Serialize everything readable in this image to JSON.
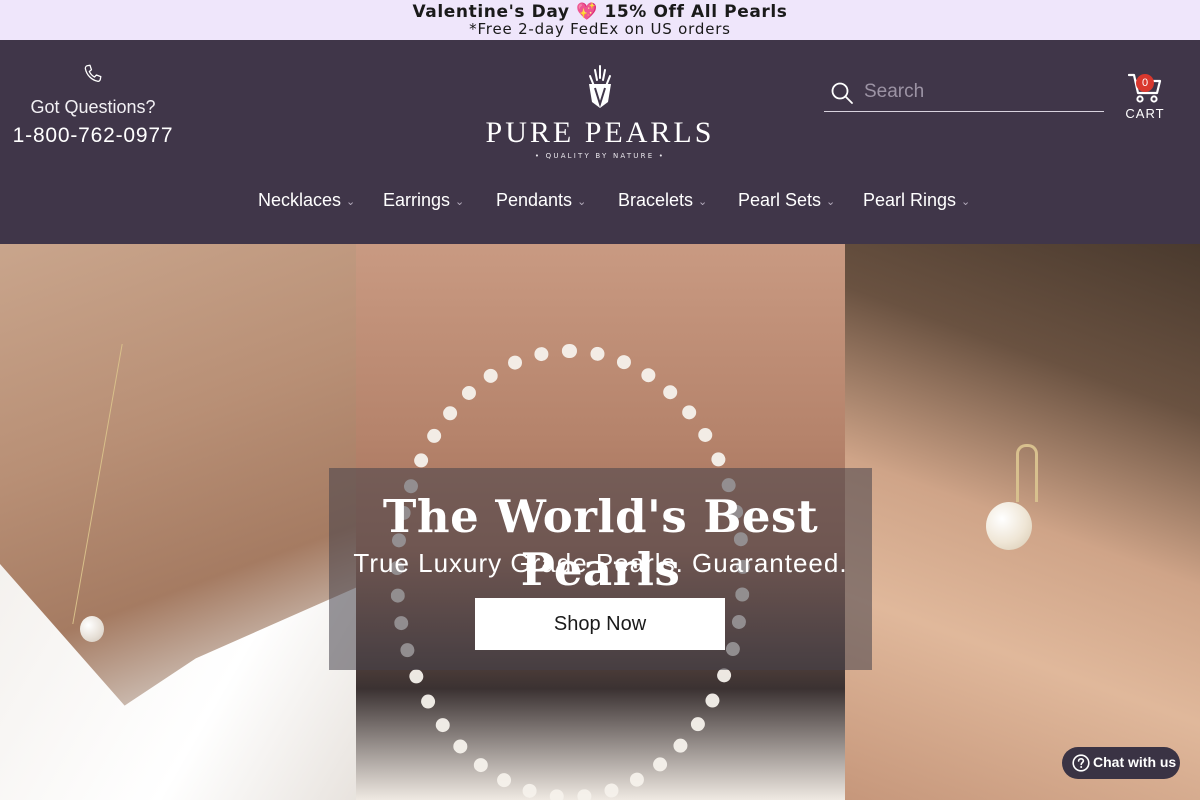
{
  "promo": {
    "line1_text": "Valentine's Day",
    "line1_heart": "💖",
    "line1_offer": "15% Off All Pearls",
    "line2": "*Free 2-day FedEx on US orders"
  },
  "header": {
    "contact": {
      "question": "Got Questions?",
      "phone": "1-800-762-0977"
    },
    "logo": {
      "brand": "PURE PEARLS",
      "tagline": "• QUALITY BY NATURE •"
    },
    "search": {
      "placeholder": "Search"
    },
    "cart": {
      "count": "0",
      "label": "CART"
    },
    "nav": [
      {
        "label": "Necklaces"
      },
      {
        "label": "Earrings"
      },
      {
        "label": "Pendants"
      },
      {
        "label": "Bracelets"
      },
      {
        "label": "Pearl Sets"
      },
      {
        "label": "Pearl Rings"
      }
    ]
  },
  "hero": {
    "title": "The World's Best Pearls",
    "subtitle": "True Luxury Grade Pearls. Guaranteed.",
    "cta": "Shop Now"
  },
  "chat": {
    "label": "Chat with us"
  },
  "colors": {
    "promo_bg": "#efe6fb",
    "header_bg": "#403649",
    "cart_badge": "#d9382e",
    "chat_bg": "#3a3344"
  },
  "icons": [
    "phone-icon",
    "search-icon",
    "cart-icon",
    "chevron-down-icon",
    "help-icon",
    "logo-emblem-icon"
  ]
}
